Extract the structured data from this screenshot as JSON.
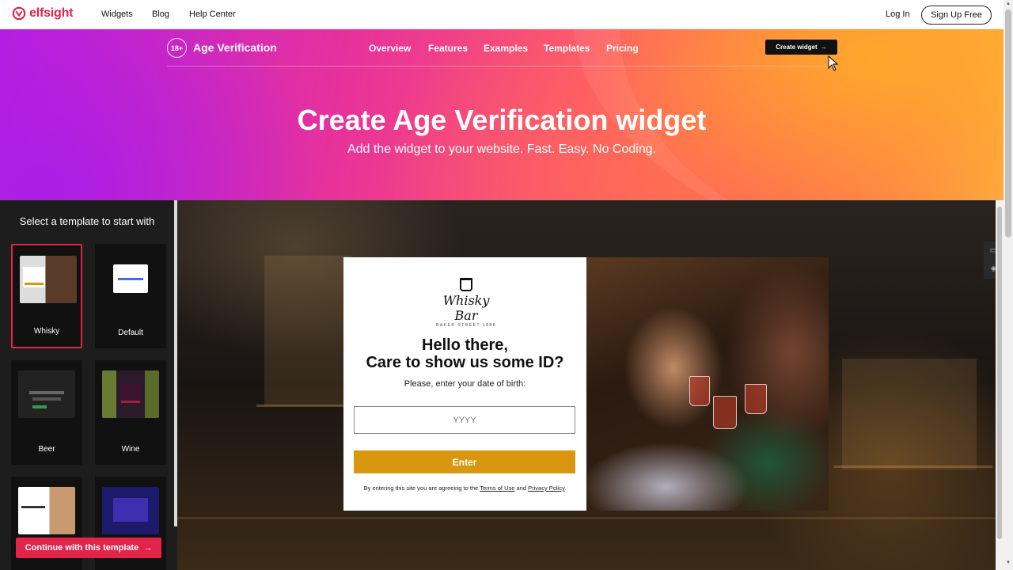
{
  "topbar": {
    "brand": "elfsight",
    "nav": [
      "Widgets",
      "Blog",
      "Help Center"
    ],
    "login": "Log In",
    "signup": "Sign Up Free"
  },
  "hero": {
    "badge": "18+",
    "product": "Age Verification",
    "subnav": [
      "Overview",
      "Features",
      "Examples",
      "Templates",
      "Pricing"
    ],
    "create_button": "Create widget",
    "title": "Create Age Verification widget",
    "subtitle": "Add the widget to your website. Fast. Easy. No Coding."
  },
  "templates": {
    "heading": "Select a template to start with",
    "items": [
      {
        "label": "Whisky",
        "selected": true
      },
      {
        "label": "Default",
        "selected": false
      },
      {
        "label": "Beer",
        "selected": false
      },
      {
        "label": "Wine",
        "selected": false
      },
      {
        "label": "",
        "selected": false
      },
      {
        "label": "",
        "selected": false
      }
    ],
    "continue_button": "Continue with this template"
  },
  "modal": {
    "logo_name": "Whisky Bar",
    "logo_tagline": "BAKER STREET 1888",
    "title_line1": "Hello there,",
    "title_line2": "Care to show us some ID?",
    "prompt": "Please, enter your date of birth:",
    "year_placeholder": "YYYY",
    "enter_button": "Enter",
    "legal_prefix": "By entering this site you are agreeing to the",
    "terms_link": "Terms of Use",
    "legal_and": "and",
    "privacy_link": "Privacy Policy",
    "legal_suffix": "."
  },
  "colors": {
    "brand": "#e2234a",
    "enter": "#d8970e"
  }
}
